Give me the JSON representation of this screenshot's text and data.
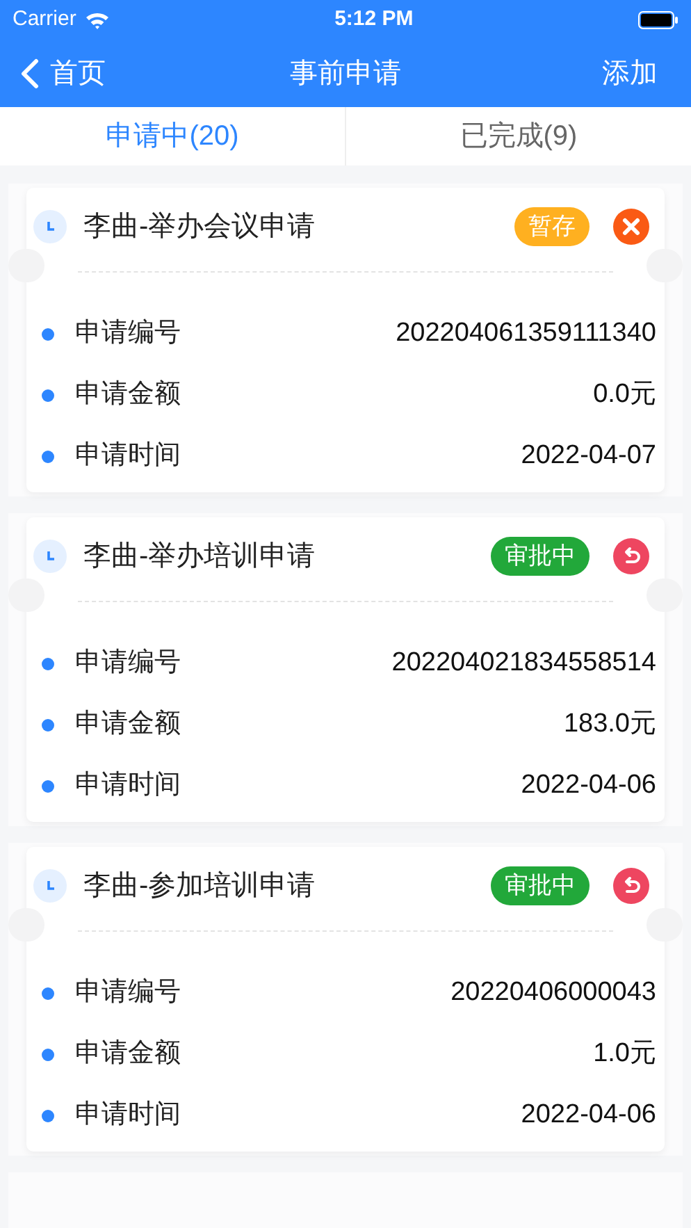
{
  "status_bar": {
    "carrier": "Carrier",
    "time": "5:12 PM"
  },
  "nav": {
    "back": "首页",
    "title": "事前申请",
    "action": "添加"
  },
  "tabs": [
    {
      "label": "申请中(20)",
      "selected": true
    },
    {
      "label": "已完成(9)",
      "selected": false
    }
  ],
  "cards": [
    {
      "title": "李曲-举办会议申请",
      "status": {
        "label": "暂存",
        "color": "#ffb020"
      },
      "kind": "delete",
      "fields": [
        {
          "label": "申请编号",
          "value": "202204061359111340"
        },
        {
          "label": "申请金额",
          "value": "0.0元"
        },
        {
          "label": "申请时间",
          "value": "2022-04-07"
        }
      ]
    },
    {
      "title": "李曲-举办培训申请",
      "status": {
        "label": "审批中",
        "color": "#22a83a"
      },
      "kind": "revoke",
      "fields": [
        {
          "label": "申请编号",
          "value": "202204021834558514"
        },
        {
          "label": "申请金额",
          "value": "183.0元"
        },
        {
          "label": "申请时间",
          "value": "2022-04-06"
        }
      ]
    },
    {
      "title": "李曲-参加培训申请",
      "status": {
        "label": "审批中",
        "color": "#22a83a"
      },
      "kind": "revoke",
      "fields": [
        {
          "label": "申请编号",
          "value": "20220406000043"
        },
        {
          "label": "申请金额",
          "value": "1.0元"
        },
        {
          "label": "申请时间",
          "value": "2022-04-06"
        }
      ]
    }
  ]
}
